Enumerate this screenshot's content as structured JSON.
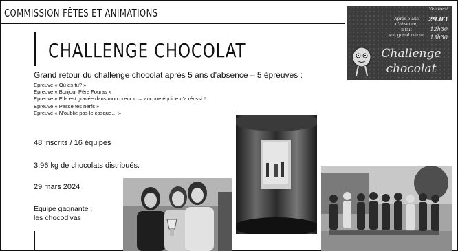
{
  "header": {
    "commission": "COMMISSION FÊTES ET ANIMATIONS"
  },
  "main": {
    "title": "CHALLENGE CHOCOLAT",
    "subtitle": "Grand retour du challenge chocolat après 5 ans d’absence – 5 épreuves :",
    "events": [
      "Epreuve « Où es-tu? »",
      "Epreuve « Bonjour Père Fouras »",
      "Epreuve « Elle est gravée dans mon cœur » → aucune équipe n’a réussi !!",
      "Epreuve « Passe tes nerfs »",
      "Epreuve « N’oublie pas le casque… »"
    ],
    "registrations": "48 inscrits / 16 équipes",
    "chocolates": "3,96 kg de chocolats distribués.",
    "date": "29 mars 2024",
    "winner_label": "Equipe gagnante :",
    "winner_team": "les chocodivas"
  },
  "poster": {
    "day": "Vendredi",
    "tagline_1": "Après 5 ans",
    "tagline_2": "d’absence,",
    "tagline_3": "il fait",
    "tagline_4": "son grand retour",
    "date": "29.03",
    "time_1": "12h30",
    "time_2": "13h30",
    "title_1": "Challenge",
    "title_2": "chocolat"
  }
}
